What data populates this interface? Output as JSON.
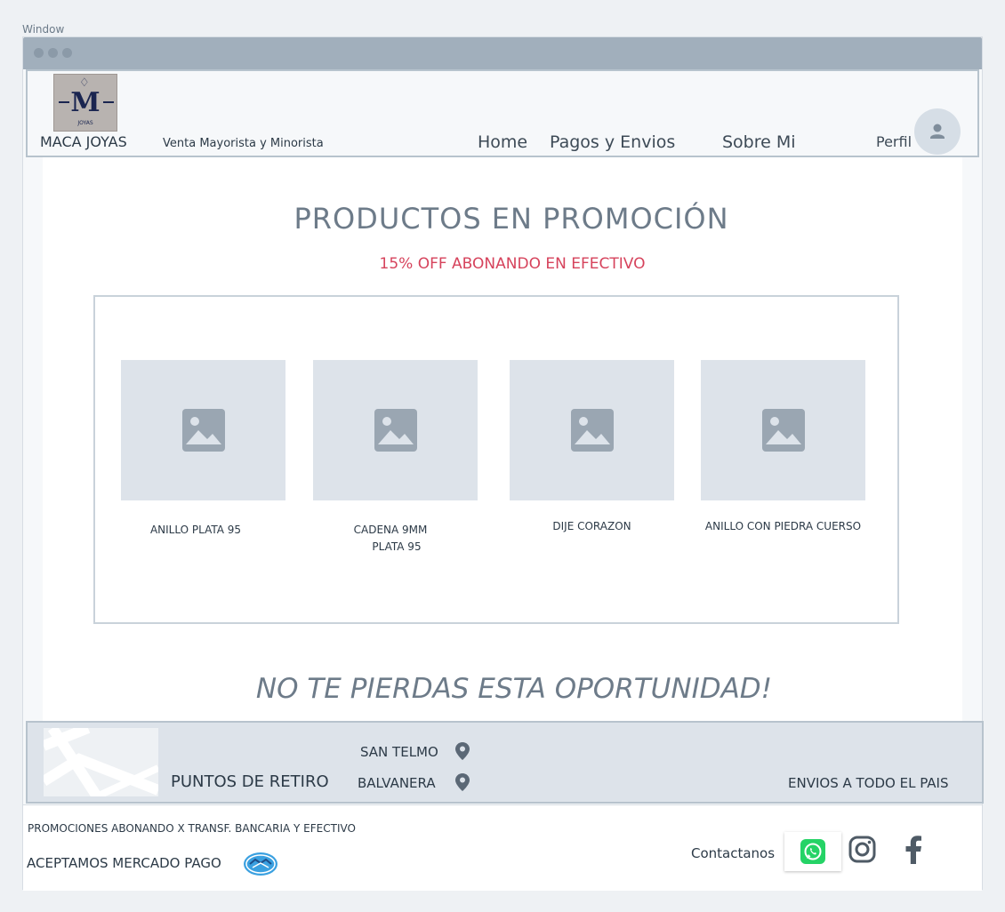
{
  "window": {
    "label": "Window"
  },
  "header": {
    "logo_text": "M",
    "logo_sub": "JOYAS",
    "brand": "MACA JOYAS",
    "tagline": "Venta Mayorista y Minorista",
    "nav": [
      {
        "label": "Home"
      },
      {
        "label": "Pagos y Envios"
      },
      {
        "label": "Sobre Mi"
      }
    ],
    "profile_label": "Perfil"
  },
  "promo": {
    "title": "PRODUCTOS EN PROMOCIÓN",
    "subtitle": "15% OFF ABONANDO EN EFECTIVO",
    "products": [
      {
        "name_line1": "ANILLO PLATA 95",
        "name_line2": ""
      },
      {
        "name_line1": "CADENA 9MM",
        "name_line2": "PLATA 95"
      },
      {
        "name_line1": "DIJE CORAZON",
        "name_line2": ""
      },
      {
        "name_line1": "ANILLO CON PIEDRA CUERSO",
        "name_line2": ""
      }
    ],
    "slogan": "NO TE PIERDAS ESTA OPORTUNIDAD!"
  },
  "pickup": {
    "title": "PUNTOS DE RETIRO",
    "locations": [
      "SAN TELMO",
      "BALVANERA"
    ],
    "shipping": "ENVIOS A TODO EL PAIS"
  },
  "footer": {
    "promo_note": "PROMOCIONES ABONANDO X TRANSF. BANCARIA Y EFECTIVO",
    "payment": "ACEPTAMOS MERCADO PAGO",
    "contact_label": "Contactanos"
  },
  "colors": {
    "accent_red": "#d6435c",
    "titlebar": "#a1afbc",
    "whatsapp": "#25d366",
    "mercadopago": "#3aa0e0"
  },
  "icons": {
    "avatar": "user-icon",
    "location": "map-pin-icon",
    "whatsapp": "whatsapp-icon",
    "instagram": "instagram-icon",
    "facebook": "facebook-icon",
    "mercadopago": "mercadopago-icon",
    "image": "image-placeholder-icon"
  }
}
